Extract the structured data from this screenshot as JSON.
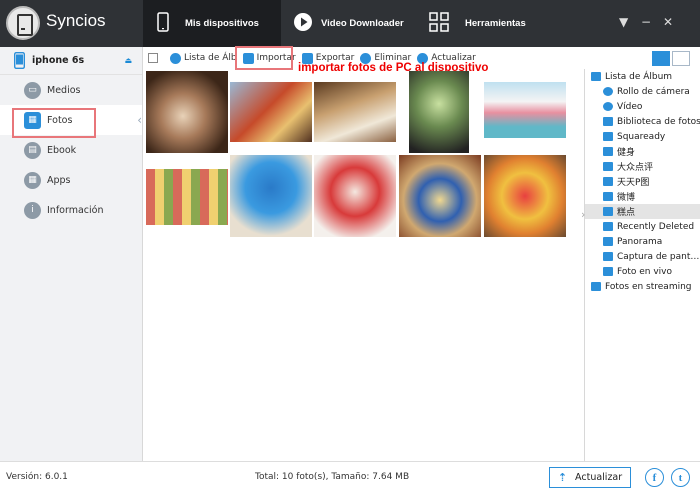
{
  "app": {
    "name": "Syncios"
  },
  "nav": [
    {
      "label": "Mis dispositivos",
      "active": true
    },
    {
      "label": "Video Downloader",
      "active": false
    },
    {
      "label": "Herramientas",
      "active": false
    }
  ],
  "window_controls": {
    "menu": "▼",
    "minimize": "−",
    "close": "✕"
  },
  "sidebar": {
    "device": "iphone 6s",
    "eject": "⏏",
    "items": [
      {
        "label": "Medios",
        "icon": "tv-icon",
        "glyph": "▭"
      },
      {
        "label": "Fotos",
        "icon": "photos-icon",
        "glyph": "▦",
        "active": true
      },
      {
        "label": "Ebook",
        "icon": "book-icon",
        "glyph": "▤"
      },
      {
        "label": "Apps",
        "icon": "apps-icon",
        "glyph": "▦"
      },
      {
        "label": "Información",
        "icon": "info-icon",
        "glyph": "i"
      }
    ]
  },
  "toolbar": {
    "album_list": "Lista de Álb",
    "import": "Importar",
    "export": "Exportar",
    "delete": "Eliminar",
    "refresh": "Actualizar"
  },
  "annotation": "importar fotos de PC al dispositivo",
  "album_panel": {
    "items": [
      {
        "label": "Lista de Álbum",
        "level": 0
      },
      {
        "label": "Rollo de cámera",
        "level": 1,
        "icon": "camera-icon"
      },
      {
        "label": "Vídeo",
        "level": 1,
        "icon": "camera-icon"
      },
      {
        "label": "Biblioteca de fotos",
        "level": 1
      },
      {
        "label": "Squaready",
        "level": 1
      },
      {
        "label": "健身",
        "level": 1
      },
      {
        "label": "大众点评",
        "level": 1
      },
      {
        "label": "天天P图",
        "level": 1
      },
      {
        "label": "微博",
        "level": 1
      },
      {
        "label": "糕点",
        "level": 1,
        "active": true
      },
      {
        "label": "Recently Deleted",
        "level": 1
      },
      {
        "label": "Panorama",
        "level": 1
      },
      {
        "label": "Captura de pant…",
        "level": 1
      },
      {
        "label": "Foto en vivo",
        "level": 1
      },
      {
        "label": "Fotos en streaming",
        "level": 0
      }
    ]
  },
  "status": {
    "version": "Versión: 6.0.1",
    "total": "Total: 10 foto(s), Tamaño: 7.64 MB",
    "update_button": "Actualizar"
  },
  "social": {
    "facebook": "f",
    "twitter": "t"
  },
  "colors": {
    "titlebar": "#2f3236",
    "accent": "#2b8fd9",
    "highlight_box": "#e8767a",
    "annotation": "#ee0000"
  }
}
